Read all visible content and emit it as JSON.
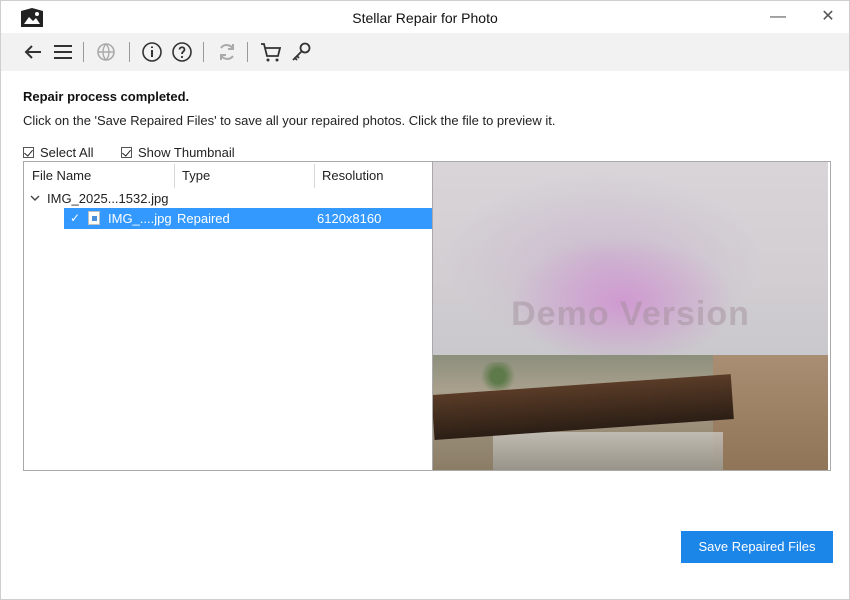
{
  "window": {
    "title": "Stellar Repair for Photo",
    "minimize_glyph": "—",
    "close_glyph": "✕"
  },
  "toolbar": {
    "items": [
      {
        "icon": "back-arrow-icon"
      },
      {
        "icon": "menu-icon"
      },
      {
        "icon": "globe-icon"
      },
      {
        "icon": "info-icon"
      },
      {
        "icon": "help-icon"
      },
      {
        "icon": "refresh-icon"
      },
      {
        "icon": "cart-icon"
      },
      {
        "icon": "key-icon"
      }
    ]
  },
  "main": {
    "headline": "Repair process completed.",
    "description": "Click on the 'Save Repaired Files' to save all your repaired photos. Click the file to preview it.",
    "select_all_label": "Select All",
    "show_thumbnail_label": "Show Thumbnail",
    "select_all_checked": true,
    "show_thumbnail_checked": true
  },
  "table": {
    "columns": [
      "File Name",
      "Type",
      "Resolution"
    ],
    "parent_row": {
      "name": "IMG_2025...1532.jpg"
    },
    "child_row": {
      "checkmark": "✓",
      "name": "IMG_....jpg",
      "type": "Repaired",
      "resolution": "6120x8160"
    }
  },
  "preview": {
    "watermark": "Demo Version"
  },
  "footer": {
    "save_label": "Save Repaired Files"
  },
  "colors": {
    "accent": "#1b85e8",
    "selection": "#3399ff",
    "toolbar_bg": "#f2f2f2"
  }
}
